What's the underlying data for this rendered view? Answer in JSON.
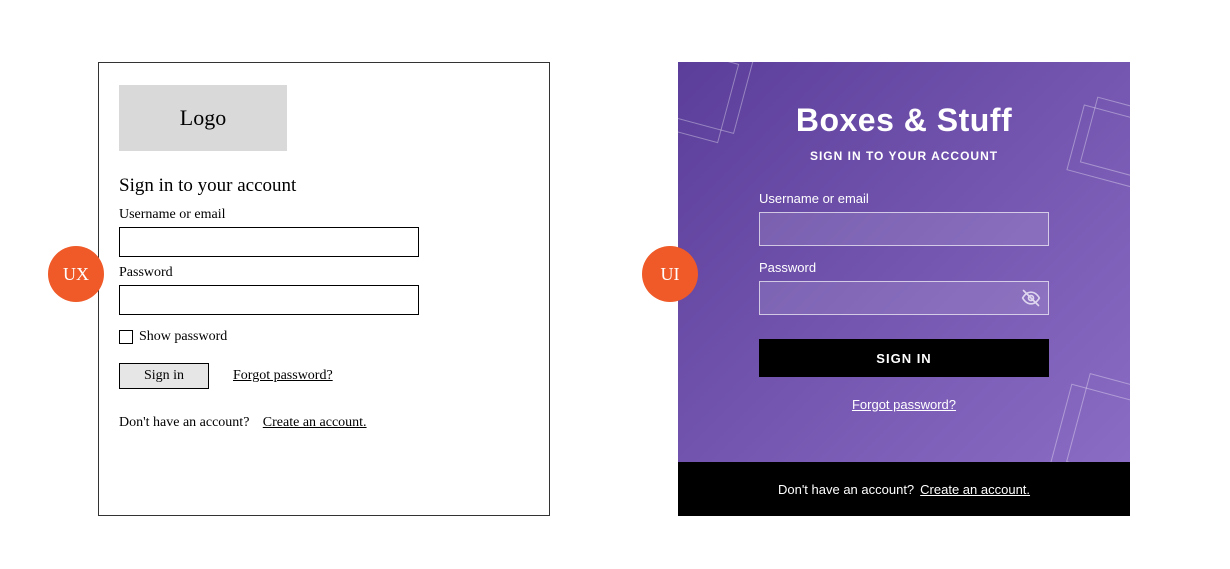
{
  "badges": {
    "ux": "UX",
    "ui": "UI"
  },
  "ux": {
    "logo": "Logo",
    "title": "Sign in to your account",
    "username_label": "Username or email",
    "password_label": "Password",
    "show_password": "Show password",
    "sign_in": "Sign in",
    "forgot": "Forgot  password?",
    "no_account": "Don't have an account?",
    "create": "Create an account."
  },
  "ui": {
    "brand": "Boxes & Stuff",
    "subtitle": "SIGN IN TO YOUR ACCOUNT",
    "username_label": "Username or email",
    "password_label": "Password",
    "sign_in": "SIGN IN",
    "forgot": "Forgot  password?",
    "no_account": "Don't have an account?",
    "create": "Create an account."
  },
  "colors": {
    "badge": "#ef5a28",
    "gradient_start": "#5b3e9a",
    "gradient_end": "#8e6fc7"
  }
}
